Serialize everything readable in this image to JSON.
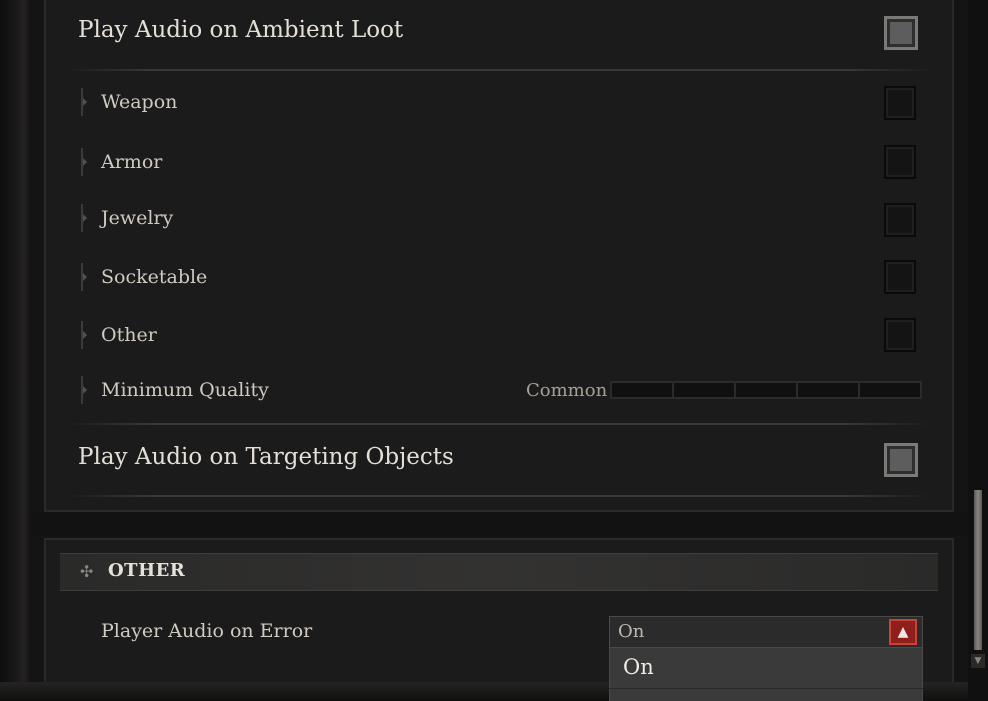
{
  "ambient_loot": {
    "title": "Play Audio on Ambient Loot",
    "checked": false,
    "items": [
      {
        "label": "Weapon",
        "checked": false
      },
      {
        "label": "Armor",
        "checked": false
      },
      {
        "label": "Jewelry",
        "checked": false
      },
      {
        "label": "Socketable",
        "checked": false
      },
      {
        "label": "Other",
        "checked": false
      }
    ],
    "minimum_quality": {
      "label": "Minimum Quality",
      "value_label": "Common",
      "segments": 5,
      "selected_level": 0
    }
  },
  "targeting": {
    "title": "Play Audio on Targeting Objects",
    "checked": false
  },
  "other_section": {
    "title": "OTHER",
    "icon": "diamond-cross-icon",
    "player_audio_on_error": {
      "label": "Player Audio on Error",
      "value": "On",
      "options": [
        "On"
      ]
    }
  },
  "colors": {
    "background": "#1b1b1b",
    "accent_red": "#8e1f1a",
    "text": "#e4dfd6"
  }
}
